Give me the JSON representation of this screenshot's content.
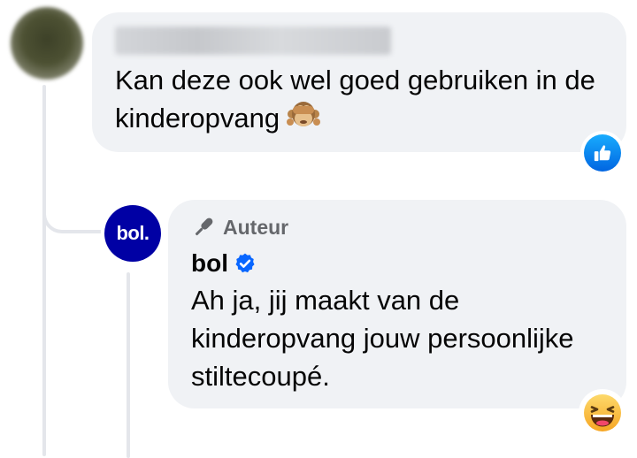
{
  "comment": {
    "author_redacted": true,
    "text": "Kan deze ook wel goed gebruiken in de kinderopvang",
    "emoji": "see-no-evil-monkey",
    "reaction": "like",
    "reaction_color": "#0866ff"
  },
  "reply": {
    "author_badge": "Auteur",
    "author_name": "bol",
    "verified": true,
    "avatar_text": "bol.",
    "avatar_color": "#0000a4",
    "text": "Ah ja, jij maakt van de kinderopvang jouw persoonlijke stiltecoupé.",
    "reaction": "haha"
  }
}
